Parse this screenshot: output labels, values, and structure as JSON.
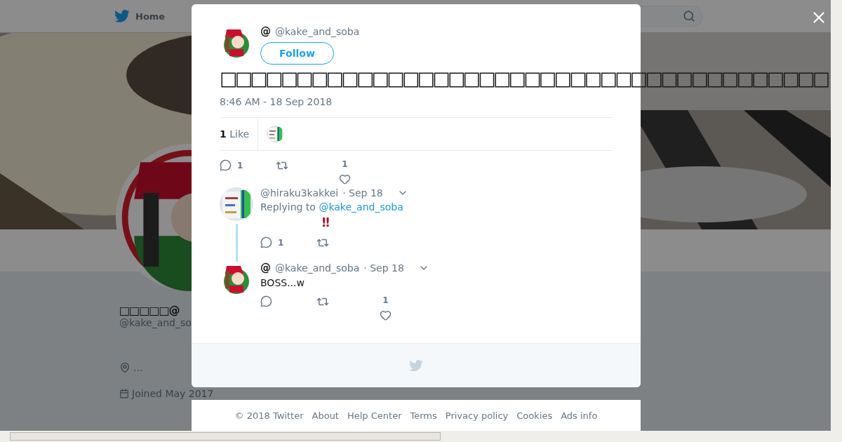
{
  "background_page": {
    "home_link": "Home",
    "profile": {
      "name": "□□□□□@",
      "handle": "@kake_and_so",
      "location": "...",
      "joined": "Joined May 2017"
    }
  },
  "tweet": {
    "name": "@",
    "handle": "@kake_and_soba",
    "follow_label": "Follow",
    "text": "□□□□□□□□□□□□□□□□□□□□□□□□□□□□□□□□□□□□□□□□",
    "time": "8:46 AM - 18 Sep 2018",
    "like_count": "1",
    "like_label": "Like",
    "reply_count": "1",
    "action_like_count": "1"
  },
  "replies": [
    {
      "handle": "@hiraku3kakkei",
      "date": "· Sep 18",
      "replying_label": "Replying to",
      "replying_to": "@kake_and_soba",
      "text": "‼",
      "reply_count": "1",
      "threaded": true
    },
    {
      "name": "@",
      "handle": "@kake_and_soba",
      "date": "· Sep 18",
      "text": "BOSS...w",
      "like_count": "1",
      "threaded": false
    }
  ],
  "footer": [
    "© 2018 Twitter",
    "About",
    "Help Center",
    "Terms",
    "Privacy policy",
    "Cookies",
    "Ads info"
  ]
}
